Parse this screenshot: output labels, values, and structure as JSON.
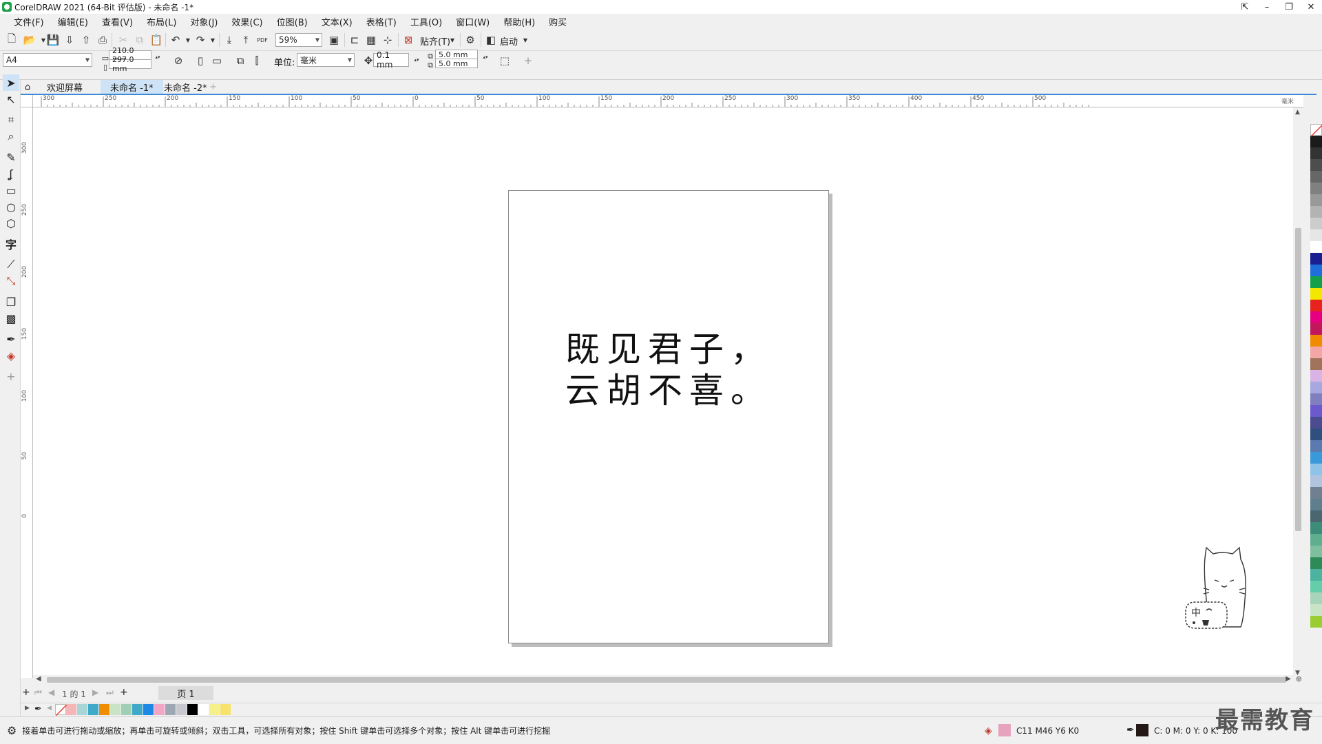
{
  "window": {
    "title": "CorelDRAW 2021 (64-Bit 评估版) - 未命名 -1*",
    "controls": [
      "⇱",
      "–",
      "❐",
      "✕"
    ]
  },
  "menu": [
    "文件(F)",
    "编辑(E)",
    "查看(V)",
    "布局(L)",
    "对象(J)",
    "效果(C)",
    "位图(B)",
    "文本(X)",
    "表格(T)",
    "工具(O)",
    "窗口(W)",
    "帮助(H)",
    "购买"
  ],
  "toolbar": {
    "zoom_value": "59%",
    "snap_label": "贴齐(T)",
    "launch_label": "启动",
    "pdf_label": "PDF"
  },
  "propbar": {
    "page_size": "A4",
    "width": "210.0 mm",
    "height": "297.0 mm",
    "unit_label": "单位:",
    "unit_value": "毫米",
    "nudge": "0.1 mm",
    "dup_x": "5.0 mm",
    "dup_y": "5.0 mm"
  },
  "tabs": [
    {
      "label": "欢迎屏幕",
      "active": false
    },
    {
      "label": "未命名 -1*",
      "active": true
    },
    {
      "label": "未命名 -2*",
      "active": false
    }
  ],
  "hruler": {
    "ticks": [
      "300",
      "250",
      "200",
      "150",
      "100",
      "50",
      "0",
      "50",
      "100",
      "150",
      "200",
      "250",
      "300",
      "350",
      "400",
      "450",
      "500"
    ],
    "unit": "毫米"
  },
  "vruler": {
    "ticks": [
      "300",
      "250",
      "200",
      "150",
      "100",
      "50",
      "0"
    ],
    "unit": "毫米"
  },
  "document": {
    "line1": "既见君子，",
    "line2": "云胡不喜。"
  },
  "mascot": {
    "badge": "中"
  },
  "pagenav": {
    "counter": "1 的 1",
    "page_tab": "页 1"
  },
  "palette_colors": [
    "#1a1a1a",
    "#333333",
    "#4d4d4d",
    "#666666",
    "#808080",
    "#999999",
    "#b3b3b3",
    "#cccccc",
    "#e6e6e6",
    "#ffffff",
    "#1b1f8f",
    "#1e6fd9",
    "#14a04a",
    "#f3e700",
    "#e8231d",
    "#e4007f",
    "#c2185b",
    "#f08c00",
    "#f3a6a6",
    "#a0735a",
    "#d9b3e6",
    "#a8a8e0",
    "#8080c0",
    "#6a5acd",
    "#4b4b8f",
    "#2f4f7f",
    "#5b7bb0",
    "#3a9ad9",
    "#8fc3e8",
    "#b0c4de",
    "#708090",
    "#5f7f8f",
    "#4a6670",
    "#3d8c7a",
    "#5fae8f",
    "#7fbfa0",
    "#2e8b57",
    "#4bb3a0",
    "#66cdaa",
    "#a8d5ba",
    "#c9e4c5",
    "#9acd32"
  ],
  "doc_palette": [
    "#f4b6b6",
    "#a8d5d5",
    "#3fa9c9",
    "#f08c00",
    "#c9e4c5",
    "#9fd0b5",
    "#3fa9c9",
    "#1e88e5",
    "#f4a6c6",
    "#9ea8b5",
    "#c8c8d0",
    "#000000",
    "#ffffff",
    "#f6f08a",
    "#f7e26b"
  ],
  "status": {
    "hint": "接着单击可进行拖动或缩放；再单击可旋转或倾斜；双击工具，可选择所有对象；按住 Shift 键单击可选择多个对象；按住 Alt 键单击可进行挖掘",
    "fill_color": "#e7a3bd",
    "fill_label": "C11 M46 Y6 K0",
    "outline_color": "#231815",
    "outline_label": "C: 0 M: 0 Y: 0 K: 100"
  },
  "watermark": "最需教育"
}
